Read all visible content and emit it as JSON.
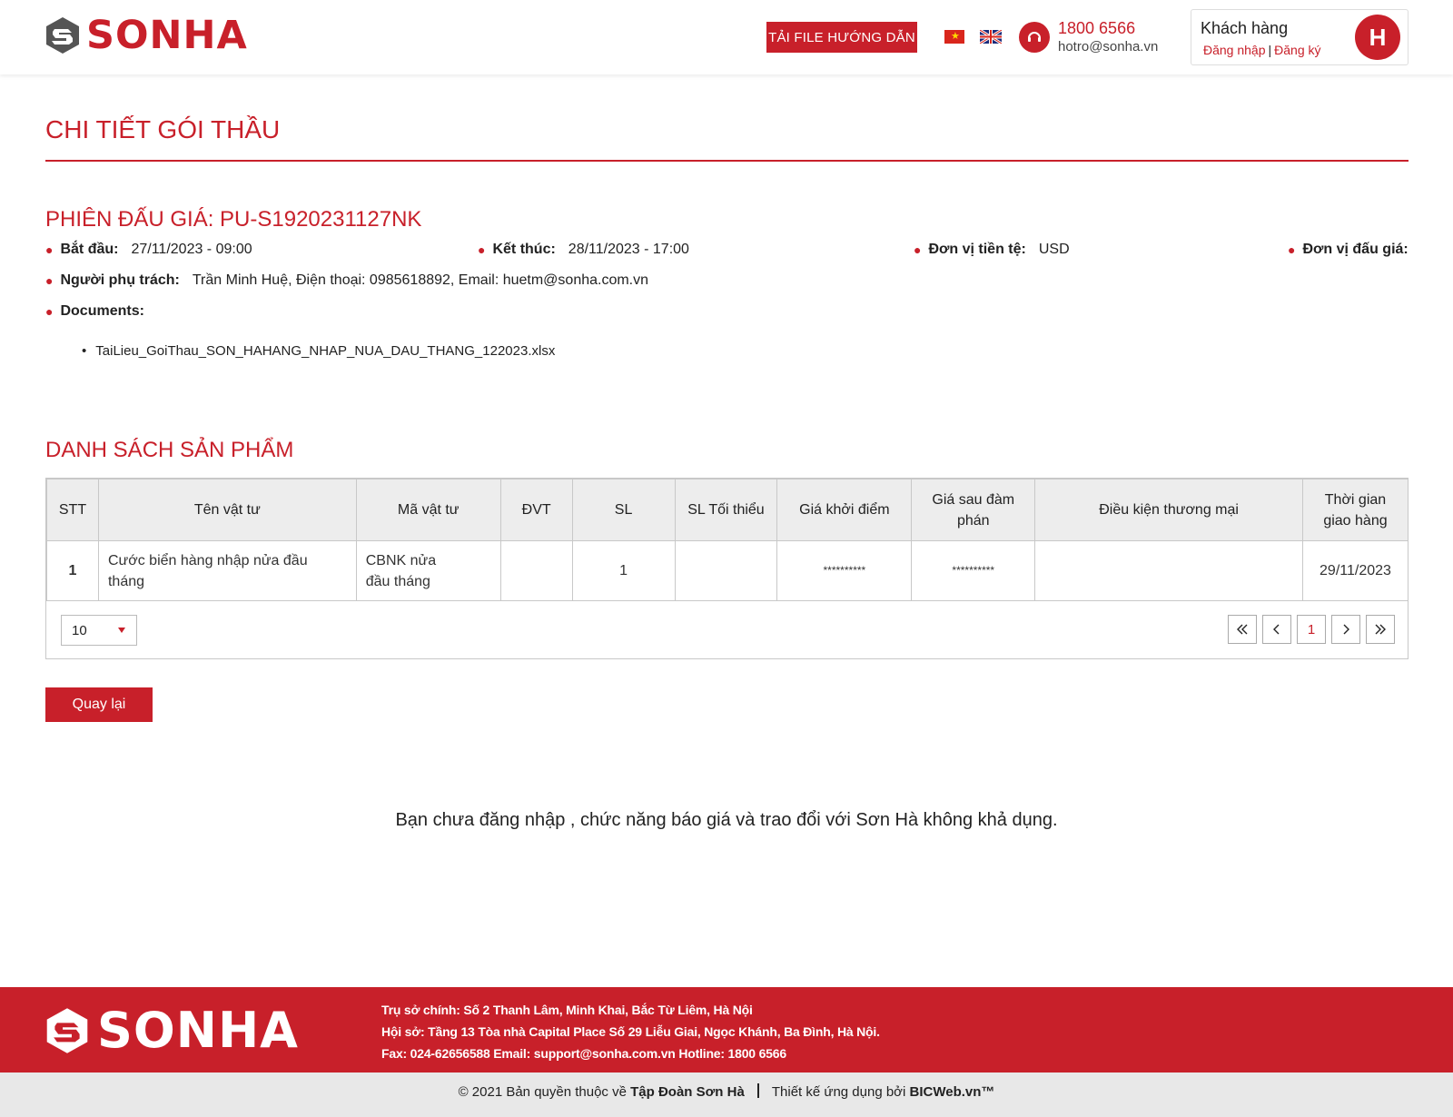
{
  "header": {
    "logo_text": "SONHA",
    "guide_button": "TẢI FILE HƯỚNG DẪN",
    "flags": [
      "vietnam-flag-icon",
      "uk-flag-icon"
    ],
    "hotline": "1800 6566",
    "support_email": "hotro@sonha.vn",
    "account": {
      "title": "Khách hàng",
      "login": "Đăng nhập",
      "separator": "|",
      "register": "Đăng ký",
      "avatar_letter": "H"
    }
  },
  "page_title": "CHI TIẾT GÓI THẦU",
  "session": {
    "title": "PHIÊN ĐẤU GIÁ: PU-S1920231127NK",
    "start_label": "Bắt đầu:",
    "start_value": "27/11/2023 - 09:00",
    "end_label": "Kết thúc:",
    "end_value": "28/11/2023 - 17:00",
    "currency_label": "Đơn vị tiền tệ:",
    "currency_value": "USD",
    "auction_unit_label": "Đơn vị đấu giá:",
    "owner_label": "Người phụ trách:",
    "owner_value": "Trần Minh Huệ, Điện thoại: 0985618892, Email: huetm@sonha.com.vn",
    "documents_label": "Documents:",
    "documents": [
      "TaiLieu_GoiThau_SON_HAHANG_NHAP_NUA_DAU_THANG_122023.xlsx"
    ]
  },
  "products": {
    "title": "DANH SÁCH SẢN PHẨM",
    "columns": [
      "STT",
      "Tên vật tư",
      "Mã vật tư",
      "ĐVT",
      "SL",
      "SL Tối thiểu",
      "Giá khởi điểm",
      "Giá sau đàm phán",
      "Điều kiện thương mại",
      "Thời gian giao hàng"
    ],
    "rows": [
      [
        "1",
        "Cước biển hàng nhập nửa đầu tháng",
        "CBNK nửa đầu tháng",
        "",
        "1",
        "",
        "**********",
        "**********",
        "",
        "29/11/2023"
      ]
    ],
    "page_size": "10",
    "current_page": "1"
  },
  "back_button": "Quay lại",
  "notice": "Bạn chưa đăng nhập , chức năng báo giá và trao đổi với Sơn Hà không khả dụng.",
  "footer": {
    "logo_text": "SONHA",
    "lines": [
      "Trụ sở chính: Số 2 Thanh Lâm, Minh Khai, Bắc Từ Liêm, Hà Nội",
      "Hội sở: Tầng 13 Tòa nhà Capital Place Số 29 Liễu Giai, Ngọc Khánh, Ba Đình, Hà Nội.",
      "Fax: 024-62656588 Email: support@sonha.com.vn Hotline: 1800 6566"
    ],
    "copyright_prefix": "© 2021 Bản quyền thuộc về",
    "copyright_owner": "Tập Đoàn Sơn Hà",
    "design_prefix": "Thiết kế ứng dụng bởi",
    "design_owner": "BICWeb.vn™"
  },
  "colors": {
    "brand": "#c8202a",
    "header_bg": "#ededed",
    "footer_bg": "#c8202a",
    "copyright_bg": "#e8e8e8"
  }
}
